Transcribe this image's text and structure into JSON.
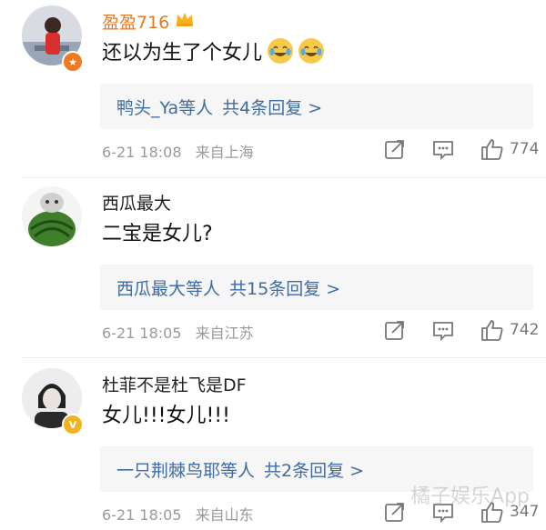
{
  "comments": [
    {
      "username": "盈盈716",
      "username_color": "#e57a22",
      "verified_badge": "crown",
      "avatar_badge": "orange-star",
      "text": "还以为生了个女儿",
      "emoji": [
        "crying-laugh-emoji",
        "crying-laugh-emoji"
      ],
      "reply_preview": {
        "name": "鸭头_Ya",
        "mid": "等人",
        "count_text": "共4条回复 >"
      },
      "timestamp": "6-21 18:08",
      "location": "来自上海",
      "likes": "774"
    },
    {
      "username": "西瓜最大",
      "username_color": "#222222",
      "text": "二宝是女儿?",
      "reply_preview": {
        "name": "西瓜最大",
        "mid": "等人",
        "count_text": "共15条回复 >"
      },
      "timestamp": "6-21 18:05",
      "location": "来自江苏",
      "likes": "742"
    },
    {
      "username": "杜菲不是杜飞是DF",
      "username_color": "#222222",
      "avatar_badge": "yellow-v",
      "text": "女儿!!!女儿!!!",
      "reply_preview": {
        "name": "一只荆棘鸟耶",
        "mid": "等人",
        "count_text": "共2条回复 >"
      },
      "timestamp": "6-21 18:05",
      "location": "来自山东",
      "likes": "347"
    }
  ],
  "watermark": "橘子娱乐App"
}
